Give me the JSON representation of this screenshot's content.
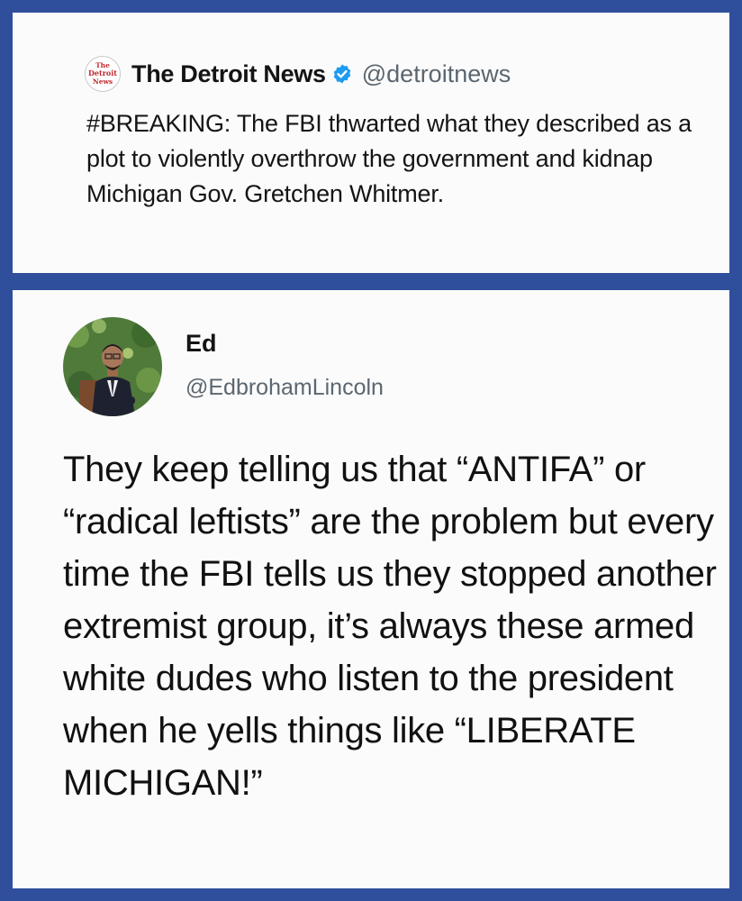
{
  "top_tweet": {
    "logo_text": "The Detroit News",
    "name": "The Detroit News",
    "handle": "@detroitnews",
    "verified": true,
    "text": "#BREAKING: The FBI thwarted what they described as a plot to violently overthrow the government and kidnap Michigan Gov. Gretchen Whitmer.",
    "icons": {
      "logo": "detroit-news-logo-icon",
      "verified": "verified-badge-icon"
    }
  },
  "bottom_tweet": {
    "name": "Ed",
    "handle": "@EdbrohamLincoln",
    "text": "They keep telling us that “ANTIFA” or “radical leftists” are the problem but every time the FBI tells us they stopped another extremist group, it’s always these armed white dudes who listen to the president when he yells things like “LIBERATE MICHIGAN!”",
    "icons": {
      "avatar": "avatar-photo"
    }
  },
  "colors": {
    "frame": "#2f4e9c",
    "card": "#fbfbfb",
    "verified": "#1d9bf0",
    "handle": "#5b6670",
    "logo_red": "#c0282d"
  }
}
